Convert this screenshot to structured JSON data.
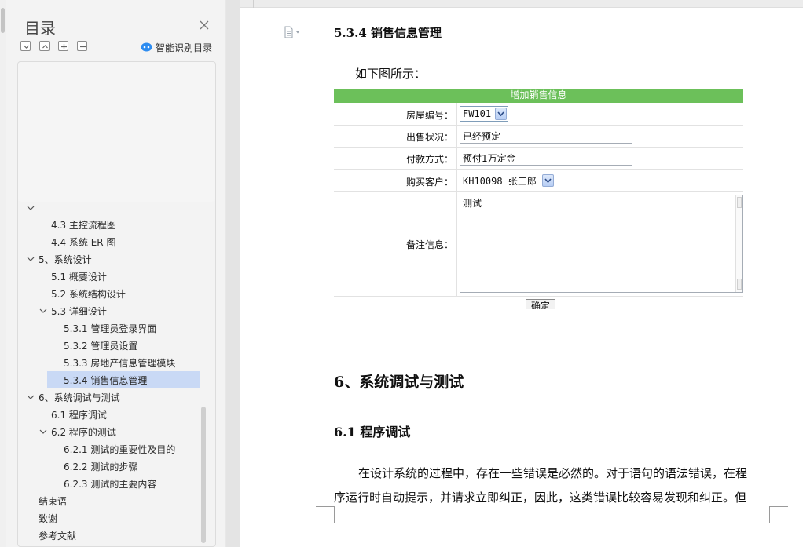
{
  "toc": {
    "title": "目录",
    "smart_label": "智能识别目录",
    "items": [
      {
        "label": "4.3  主控流程图"
      },
      {
        "label": "4.4  系统 ER 图"
      },
      {
        "label": "5、系统设计"
      },
      {
        "label": "5.1  概要设计"
      },
      {
        "label": "5.2  系统结构设计"
      },
      {
        "label": "5.3  详细设计"
      },
      {
        "label": "5.3.1  管理员登录界面"
      },
      {
        "label": "5.3.2  管理员设置"
      },
      {
        "label": "5.3.3  房地产信息管理模块"
      },
      {
        "label": "5.3.4  销售信息管理"
      },
      {
        "label": "6、系统调试与测试"
      },
      {
        "label": "6.1  程序调试"
      },
      {
        "label": "6.2  程序的测试"
      },
      {
        "label": "6.2.1  测试的重要性及目的"
      },
      {
        "label": "6.2.2  测试的步骤"
      },
      {
        "label": "6.2.3  测试的主要内容"
      },
      {
        "label": "结束语"
      },
      {
        "label": "致谢"
      },
      {
        "label": "参考文献"
      }
    ]
  },
  "doc": {
    "heading_534": "5.3.4  销售信息管理",
    "intro": "如下图所示：",
    "form": {
      "header": "增加销售信息",
      "house_label": "房屋编号：",
      "house_value": "FW101",
      "status_label": "出售状况：",
      "status_value": "已经预定",
      "payment_label": "付款方式：",
      "payment_value": "预付1万定金",
      "customer_label": "购买客户：",
      "customer_value": "KH10098 张三郎",
      "note_label": "备注信息：",
      "note_value": "测试",
      "confirm_label": "确定"
    },
    "heading_6": "6、系统调试与测试",
    "heading_61": "6.1  程序调试",
    "para_line1": "在设计系统的过程中，存在一些错误是必然的。对于语句的语法错误，在程",
    "para_line2": "序运行时自动提示，并请求立即纠正，因此，这类错误比较容易发现和纠正。但"
  },
  "colors": {
    "form_header": "#6cc05a",
    "toc_active": "#c9d9f5",
    "smart_icon": "#2d8cf0"
  }
}
